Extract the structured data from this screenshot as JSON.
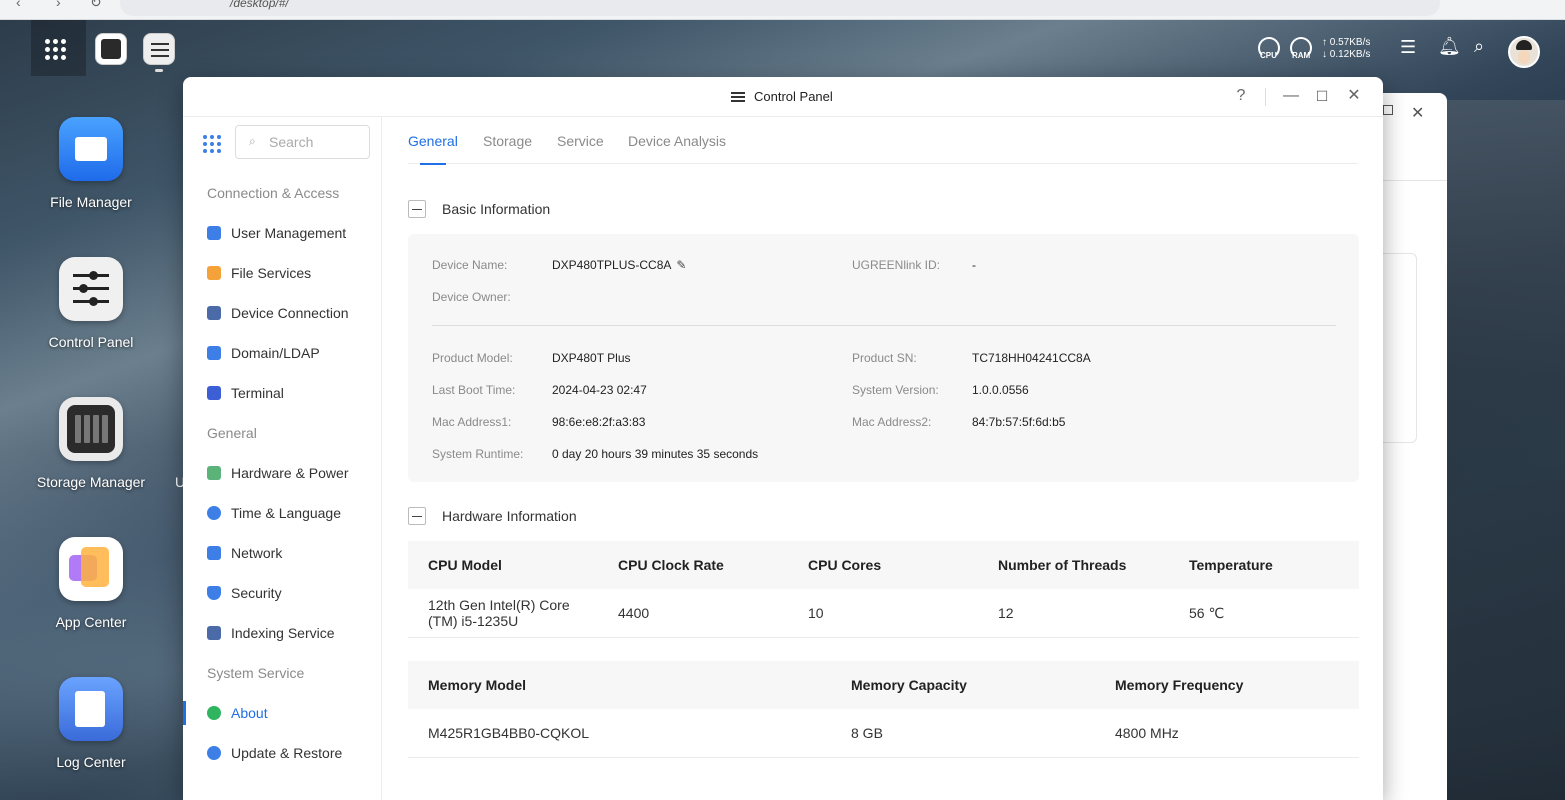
{
  "browser": {
    "url_text": "/desktop/#/"
  },
  "taskbar": {
    "cpu_label": "CPU",
    "ram_label": "RAM",
    "upload_rate": "↑ 0.57KB/s",
    "download_rate": "↓ 0.12KB/s"
  },
  "desktop": {
    "apps": [
      {
        "label": "File Manager"
      },
      {
        "label": "Control Panel"
      },
      {
        "label": "Storage Manager"
      },
      {
        "label": "App Center"
      },
      {
        "label": "Log Center"
      }
    ],
    "partial_label": "U"
  },
  "window": {
    "title": "Control Panel",
    "help_glyph": "?",
    "minimize_glyph": "—",
    "close_glyph": "✕"
  },
  "sidebar": {
    "search_placeholder": "Search",
    "sections": [
      {
        "title": "Connection & Access"
      },
      {
        "title": "General"
      },
      {
        "title": "System Service"
      }
    ],
    "items": [
      {
        "label": "User Management",
        "color": "#3d7fe6"
      },
      {
        "label": "File Services",
        "color": "#f5a23a"
      },
      {
        "label": "Device Connection",
        "color": "#4a6aa8"
      },
      {
        "label": "Domain/LDAP",
        "color": "#3d7fe6"
      },
      {
        "label": "Terminal",
        "color": "#3d5fd6"
      },
      {
        "label": "Hardware & Power",
        "color": "#5bb37a"
      },
      {
        "label": "Time & Language",
        "color": "#3d7fe6"
      },
      {
        "label": "Network",
        "color": "#3d7fe6"
      },
      {
        "label": "Security",
        "color": "#3d7fe6"
      },
      {
        "label": "Indexing Service",
        "color": "#4a6aa8"
      },
      {
        "label": "About",
        "color": "#2fb560"
      },
      {
        "label": "Update & Restore",
        "color": "#3d7fe6"
      }
    ]
  },
  "tabs": [
    {
      "label": "General"
    },
    {
      "label": "Storage"
    },
    {
      "label": "Service"
    },
    {
      "label": "Device Analysis"
    }
  ],
  "basic": {
    "title": "Basic Information",
    "device_name_label": "Device Name:",
    "device_name": "DXP480TPLUS-CC8A",
    "ugreenlink_label": "UGREENlink ID:",
    "ugreenlink": "-",
    "owner_label": "Device Owner:",
    "product_model_label": "Product Model:",
    "product_model": "DXP480T Plus",
    "product_sn_label": "Product SN:",
    "product_sn": "TC718HH04241CC8A",
    "boot_label": "Last Boot Time:",
    "boot": "2024-04-23 02:47",
    "sysver_label": "System Version:",
    "sysver": "1.0.0.0556",
    "mac1_label": "Mac Address1:",
    "mac1": "98:6e:e8:2f:a3:83",
    "mac2_label": "Mac Address2:",
    "mac2": "84:7b:57:5f:6d:b5",
    "runtime_label": "System Runtime:",
    "runtime": "0 day 20 hours 39 minutes 35 seconds"
  },
  "hardware": {
    "title": "Hardware Information",
    "cpu_headers": [
      "CPU Model",
      "CPU Clock Rate",
      "CPU Cores",
      "Number of Threads",
      "Temperature"
    ],
    "cpu_row": [
      "12th Gen Intel(R) Core (TM) i5-1235U",
      "4400",
      "10",
      "12",
      "56 ℃"
    ],
    "mem_headers": [
      "Memory Model",
      "Memory Capacity",
      "Memory Frequency"
    ],
    "mem_row": [
      "M425R1GB4BB0-CQKOL",
      "8 GB",
      "4800 MHz"
    ]
  }
}
